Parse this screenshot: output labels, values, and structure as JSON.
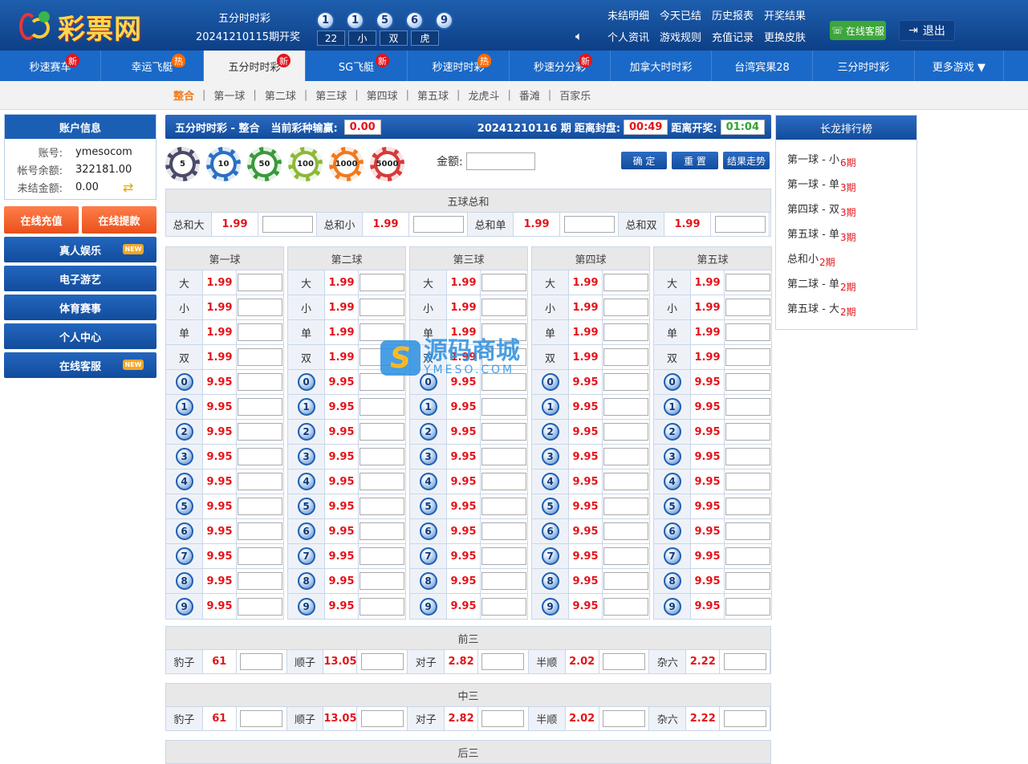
{
  "header": {
    "logo_text": "彩票网",
    "game_name": "五分时时彩",
    "issue_open": "20241210115期开奖",
    "balls": [
      "1",
      "1",
      "5",
      "6",
      "9"
    ],
    "summary": [
      "22",
      "小",
      "双",
      "虎"
    ],
    "links": [
      "未结明细",
      "今天已结",
      "历史报表",
      "开奖结果",
      "个人资讯",
      "游戏规则",
      "充值记录",
      "更换皮肤"
    ],
    "customer_service": "在线客服",
    "logout": "退出"
  },
  "nav": [
    {
      "label": "秒速赛车",
      "badge": "新",
      "type": "new"
    },
    {
      "label": "幸运飞艇",
      "badge": "热",
      "type": "hot"
    },
    {
      "label": "五分时时彩",
      "badge": "新",
      "type": "new",
      "active": true
    },
    {
      "label": "SG飞艇",
      "badge": "新",
      "type": "new"
    },
    {
      "label": "秒速时时彩",
      "badge": "热",
      "type": "hot"
    },
    {
      "label": "秒速分分彩",
      "badge": "新",
      "type": "new"
    },
    {
      "label": "加拿大时时彩",
      "badge": "",
      "type": ""
    },
    {
      "label": "台湾宾果28",
      "badge": "",
      "type": ""
    },
    {
      "label": "三分时时彩",
      "badge": "",
      "type": ""
    },
    {
      "label": "更多游戏 ▼",
      "badge": "",
      "type": ""
    }
  ],
  "subnav": [
    "整合",
    "第一球",
    "第二球",
    "第三球",
    "第四球",
    "第五球",
    "龙虎斗",
    "番滩",
    "百家乐"
  ],
  "account": {
    "title": "账户信息",
    "rows": [
      {
        "k": "账号:",
        "v": "ymesocom"
      },
      {
        "k": "帐号余额:",
        "v": "322181.00"
      },
      {
        "k": "未结金额:",
        "v": "0.00"
      }
    ],
    "recharge": "在线充值",
    "withdraw": "在线提款"
  },
  "side_menu": [
    {
      "label": "真人娱乐",
      "new": "NEW"
    },
    {
      "label": "电子游艺",
      "new": ""
    },
    {
      "label": "体育赛事",
      "new": ""
    },
    {
      "label": "个人中心",
      "new": ""
    },
    {
      "label": "在线客服",
      "new": "NEW"
    }
  ],
  "bet": {
    "title": "五分时时彩 - 整合",
    "pl_label": "当前彩种输赢:",
    "pl_value": "0.00",
    "issue": "20241210116 期",
    "close_label": "距离封盘:",
    "close_time": "00:49",
    "open_label": "距离开奖:",
    "open_time": "01:04",
    "chips": [
      {
        "v": "5",
        "color": "#4a4a68"
      },
      {
        "v": "10",
        "color": "#2b6fc4"
      },
      {
        "v": "50",
        "color": "#3a9a3a"
      },
      {
        "v": "100",
        "color": "#8db83a"
      },
      {
        "v": "1000",
        "color": "#f07a1f"
      },
      {
        "v": "5000",
        "color": "#d83a3a"
      }
    ],
    "amount_label": "金额:",
    "confirm": "确 定",
    "reset": "重 置",
    "trend": "结果走势"
  },
  "total": {
    "head": "五球总和",
    "cells": [
      {
        "label": "总和大",
        "odds": "1.99"
      },
      {
        "label": "总和小",
        "odds": "1.99"
      },
      {
        "label": "总和单",
        "odds": "1.99"
      },
      {
        "label": "总和双",
        "odds": "1.99"
      }
    ]
  },
  "balls_cols": {
    "heads": [
      "第一球",
      "第二球",
      "第三球",
      "第四球",
      "第五球"
    ],
    "text_rows": [
      {
        "label": "大",
        "odds": "1.99"
      },
      {
        "label": "小",
        "odds": "1.99"
      },
      {
        "label": "单",
        "odds": "1.99"
      },
      {
        "label": "双",
        "odds": "1.99"
      }
    ],
    "num_odds": "9.95",
    "numbers": [
      "0",
      "1",
      "2",
      "3",
      "4",
      "5",
      "6",
      "7",
      "8",
      "9"
    ]
  },
  "qian": {
    "head": "前三",
    "cells": [
      {
        "label": "豹子",
        "odds": "61"
      },
      {
        "label": "顺子",
        "odds": "13.05"
      },
      {
        "label": "对子",
        "odds": "2.82"
      },
      {
        "label": "半顺",
        "odds": "2.02"
      },
      {
        "label": "杂六",
        "odds": "2.22"
      }
    ]
  },
  "zhong": {
    "head": "中三",
    "cells": [
      {
        "label": "豹子",
        "odds": "61"
      },
      {
        "label": "顺子",
        "odds": "13.05"
      },
      {
        "label": "对子",
        "odds": "2.82"
      },
      {
        "label": "半顺",
        "odds": "2.02"
      },
      {
        "label": "杂六",
        "odds": "2.22"
      }
    ]
  },
  "hou": {
    "head": "后三"
  },
  "rank": {
    "title": "长龙排行榜",
    "items": [
      {
        "name": "第一球 - 小",
        "count": "6期"
      },
      {
        "name": "第一球 - 单",
        "count": "3期"
      },
      {
        "name": "第四球 - 双",
        "count": "3期"
      },
      {
        "name": "第五球 - 单",
        "count": "3期"
      },
      {
        "name": "总和小",
        "count": "2期"
      },
      {
        "name": "第二球 - 单",
        "count": "2期"
      },
      {
        "name": "第五球 - 大",
        "count": "2期"
      }
    ]
  },
  "watermark": {
    "cn": "源码商城",
    "en": "YMESO.COM",
    "s": "S"
  }
}
